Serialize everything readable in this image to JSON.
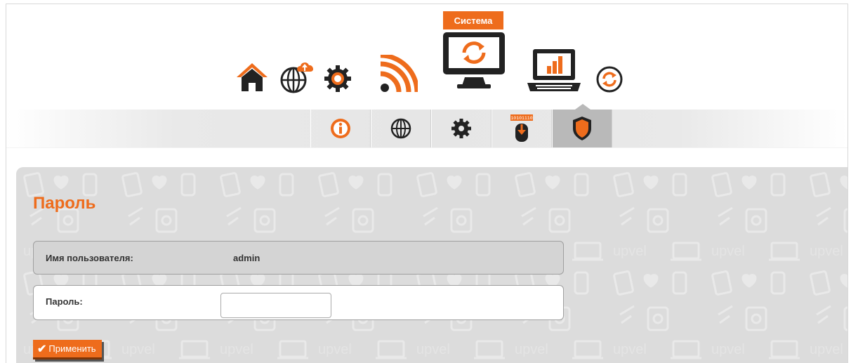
{
  "topnav": {
    "items": [
      {
        "icon": "home-icon"
      },
      {
        "icon": "globe-cloud-icon"
      },
      {
        "icon": "gear-icon"
      },
      {
        "icon": "wifi-icon"
      },
      {
        "icon": "monitor-sync-icon",
        "label": "Система",
        "active": true
      },
      {
        "icon": "laptop-stats-icon"
      },
      {
        "icon": "refresh-icon"
      }
    ],
    "active_label": "Система"
  },
  "subnav": {
    "items": [
      {
        "icon": "info-icon"
      },
      {
        "icon": "globe-icon"
      },
      {
        "icon": "gear-icon"
      },
      {
        "icon": "firmware-icon",
        "badge": "10101110"
      },
      {
        "icon": "shield-icon",
        "active": true
      }
    ]
  },
  "page": {
    "title": "Пароль",
    "username_label": "Имя пользователя:",
    "username_value": "admin",
    "password_label": "Пароль:",
    "password_value": "",
    "apply_label": "Применить",
    "apply_check": "✔"
  },
  "pattern": {
    "text": "upvel"
  },
  "colors": {
    "accent": "#ee6c1c",
    "dark_icon": "#222222",
    "panel_bg": "#dcdcdc"
  }
}
